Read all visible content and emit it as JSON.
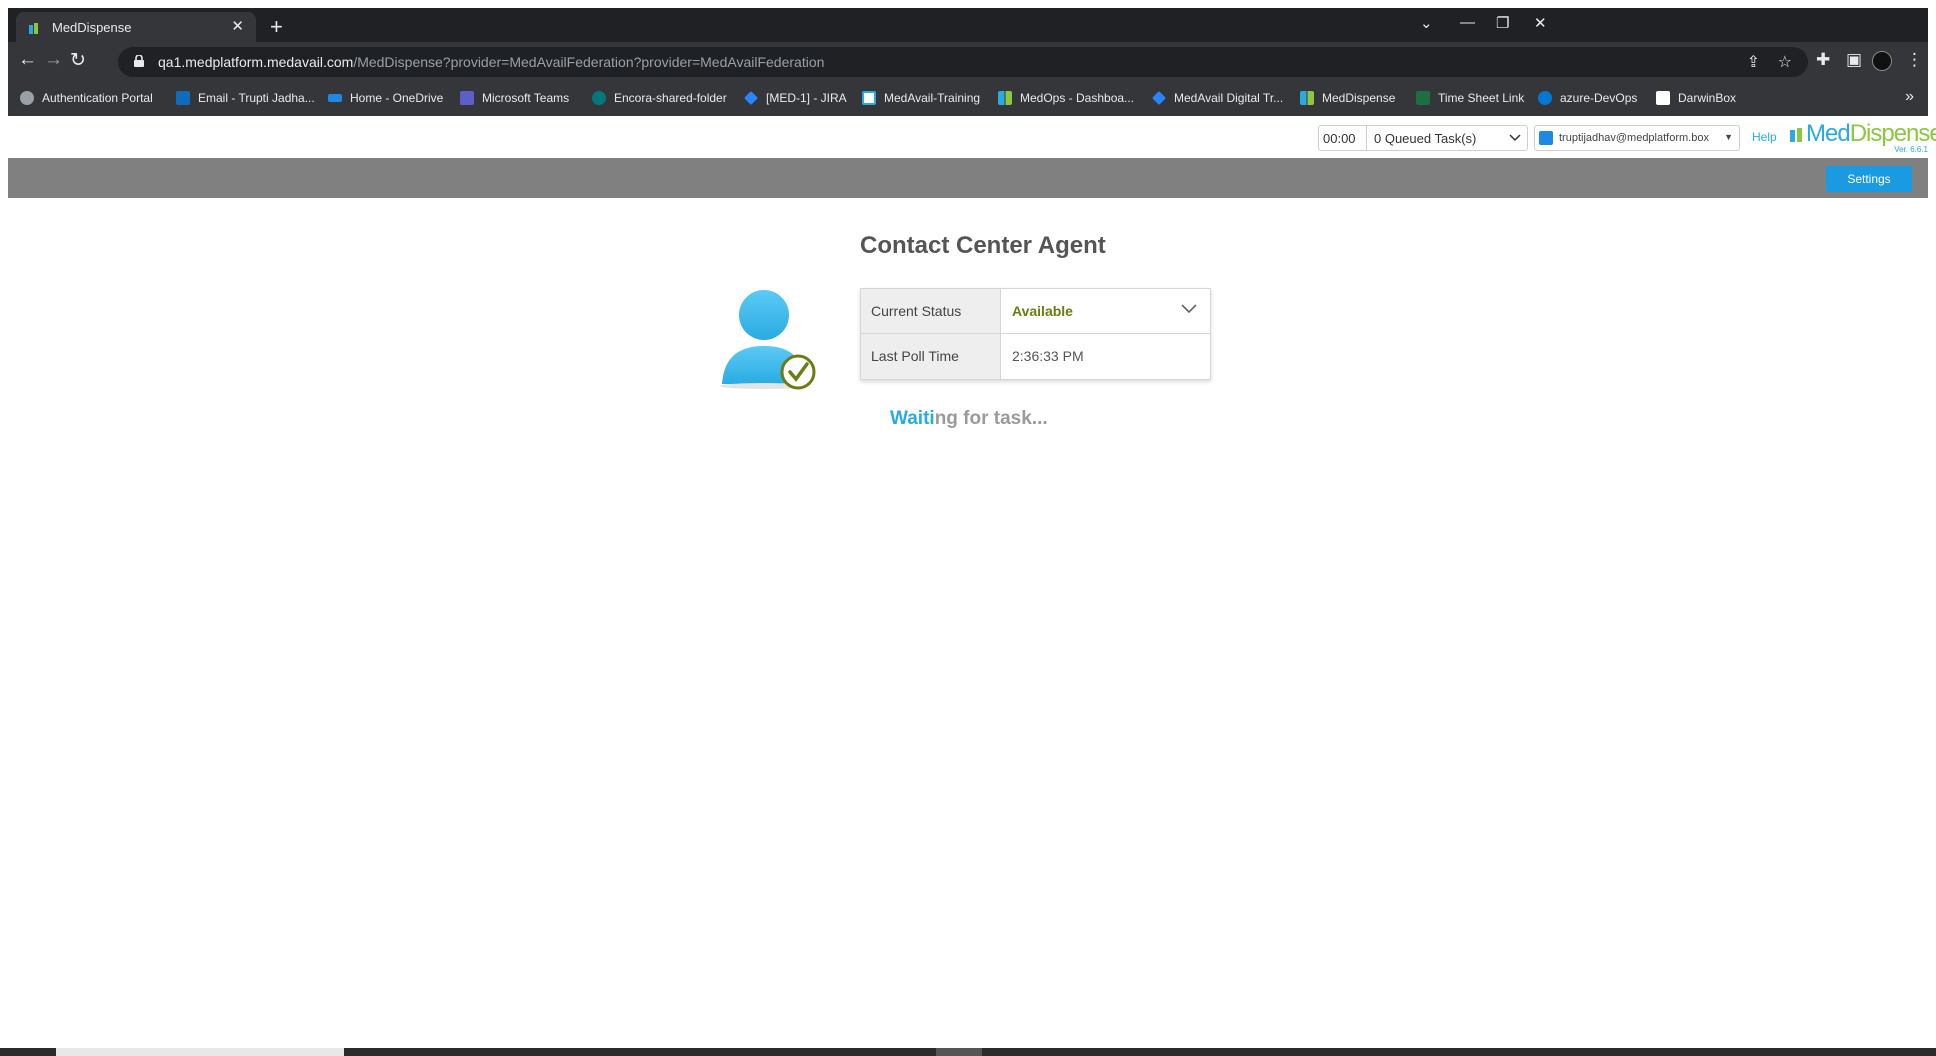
{
  "browser": {
    "tab_title": "MedDispense",
    "url_host": "qa1.medplatform.medavail.com",
    "url_rest": "/MedDispense?provider=MedAvailFederation?provider=MedAvailFederation",
    "bookmarks": [
      {
        "label": "Authentication Portal",
        "icon": "globe-icon",
        "color": "#9aa0a6"
      },
      {
        "label": "Email - Trupti Jadha...",
        "icon": "outlook-icon",
        "color": "#0f6cbd"
      },
      {
        "label": "Home - OneDrive",
        "icon": "onedrive-icon",
        "color": "#1e88e5"
      },
      {
        "label": "Microsoft Teams",
        "icon": "teams-icon",
        "color": "#5b5fc7"
      },
      {
        "label": "Encora-shared-folder",
        "icon": "sharepoint-icon",
        "color": "#03787c"
      },
      {
        "label": "[MED-1] - JIRA",
        "icon": "jira-icon",
        "color": "#2684ff"
      },
      {
        "label": "MedAvail-Training",
        "icon": "medavail-icon",
        "color": "#ffffff"
      },
      {
        "label": "MedOps - Dashboa...",
        "icon": "meddispense-icon",
        "color": "#8dc63f"
      },
      {
        "label": "MedAvail Digital Tr...",
        "icon": "jira-icon",
        "color": "#2684ff"
      },
      {
        "label": "MedDispense",
        "icon": "meddispense-icon",
        "color": "#8dc63f"
      },
      {
        "label": "Time Sheet Link",
        "icon": "excel-icon",
        "color": "#1d6f42"
      },
      {
        "label": "azure-DevOps",
        "icon": "azure-devops-icon",
        "color": "#0078d4"
      },
      {
        "label": "DarwinBox",
        "icon": "darwinbox-icon",
        "color": "#ffffff"
      }
    ]
  },
  "header": {
    "timer": "00:00",
    "queued_label": "0   Queued Task(s)",
    "user_email": "truptijadhav@medplatform.box",
    "help_label": "Help",
    "logo_med": "Med",
    "logo_dispense": "Dispense",
    "version": "Ver. 6.6.1",
    "settings_label": "Settings"
  },
  "main": {
    "title": "Contact Center Agent",
    "rows": [
      {
        "label": "Current Status",
        "value": "Available"
      },
      {
        "label": "Last Poll Time",
        "value": "2:36:33 PM"
      }
    ],
    "waiting_hl": "Waiti",
    "waiting_rest": "ng for task..."
  },
  "colors": {
    "accent": "#29abe2",
    "brand_green": "#8dc63f",
    "status_available": "#6b7d12",
    "settings_button": "#1a9ae0"
  }
}
